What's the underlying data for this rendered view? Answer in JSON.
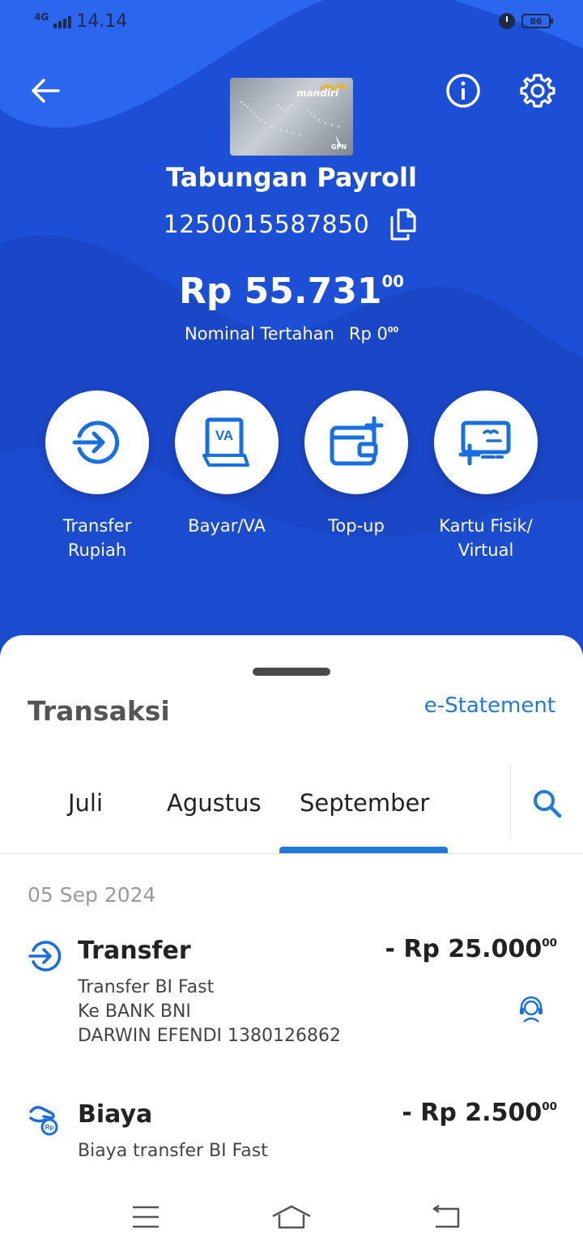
{
  "status_bar": {
    "network": "4G",
    "time": "14.14",
    "battery": "86"
  },
  "account": {
    "card_brand": "mandiri",
    "card_network": "GPN",
    "name": "Tabungan Payroll",
    "number": "1250015587850",
    "balance_main": "Rp 55.731",
    "balance_cents": "00",
    "held_label": "Nominal Tertahan",
    "held_main": "Rp 0",
    "held_cents": "00"
  },
  "actions": [
    {
      "label": "Transfer Rupiah",
      "icon": "transfer-icon"
    },
    {
      "label": "Bayar/VA",
      "icon": "va-icon"
    },
    {
      "label": "Top-up",
      "icon": "wallet-plus-icon"
    },
    {
      "label": "Kartu Fisik/ Virtual",
      "icon": "card-plus-icon"
    }
  ],
  "transactions": {
    "title": "Transaksi",
    "estatement": "e-Statement",
    "tabs": [
      "Juli",
      "Agustus",
      "September"
    ],
    "active_tab": "September",
    "date": "05 Sep 2024",
    "items": [
      {
        "title": "Transfer",
        "amount_main": "- Rp 25.000",
        "amount_cents": "00",
        "lines": [
          "Transfer BI Fast",
          "Ke BANK BNI",
          "DARWIN EFENDI 1380126862"
        ]
      },
      {
        "title": "Biaya",
        "amount_main": "- Rp 2.500",
        "amount_cents": "00",
        "lines": [
          "Biaya transfer BI Fast"
        ]
      }
    ]
  },
  "colors": {
    "primary": "#1d4fd6",
    "accent": "#1f7ad8",
    "action_icon": "#1a6fe0"
  }
}
